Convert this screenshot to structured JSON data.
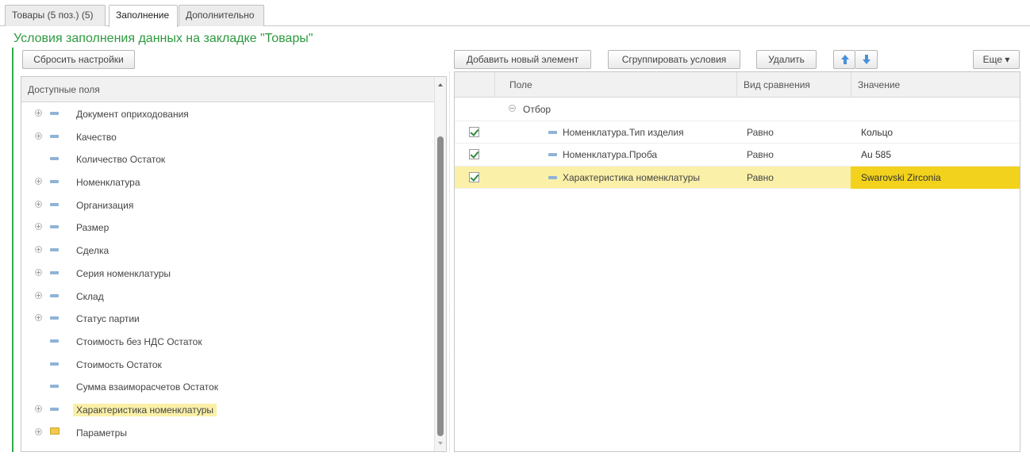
{
  "tabs": [
    {
      "label": "Товары (5 поз.) (5)"
    },
    {
      "label": "Заполнение"
    },
    {
      "label": "Дополнительно"
    }
  ],
  "section_title": "Условия заполнения данных на закладке \"Товары\"",
  "buttons": {
    "reset": "Сбросить настройки",
    "add": "Добавить новый элемент",
    "group": "Сгруппировать условия",
    "delete": "Удалить",
    "more": "Еще ▾"
  },
  "available_fields": {
    "header": "Доступные поля",
    "items": [
      {
        "label": "Документ оприходования",
        "expandable": true,
        "icon": "field-icon"
      },
      {
        "label": "Качество",
        "expandable": true,
        "icon": "field-icon"
      },
      {
        "label": "Количество Остаток",
        "expandable": false,
        "icon": "field-icon"
      },
      {
        "label": "Номенклатура",
        "expandable": true,
        "icon": "field-icon"
      },
      {
        "label": "Организация",
        "expandable": true,
        "icon": "field-icon"
      },
      {
        "label": "Размер",
        "expandable": true,
        "icon": "field-icon"
      },
      {
        "label": "Сделка",
        "expandable": true,
        "icon": "field-icon"
      },
      {
        "label": "Серия номенклатуры",
        "expandable": true,
        "icon": "field-icon"
      },
      {
        "label": "Склад",
        "expandable": true,
        "icon": "field-icon"
      },
      {
        "label": "Статус партии",
        "expandable": true,
        "icon": "field-icon"
      },
      {
        "label": "Стоимость без НДС Остаток",
        "expandable": false,
        "icon": "field-icon"
      },
      {
        "label": "Стоимость Остаток",
        "expandable": false,
        "icon": "field-icon"
      },
      {
        "label": "Сумма взаиморасчетов Остаток",
        "expandable": false,
        "icon": "field-icon"
      },
      {
        "label": "Характеристика номенклатуры",
        "expandable": true,
        "icon": "field-icon",
        "highlighted": true
      },
      {
        "label": "Параметры",
        "expandable": true,
        "icon": "folder-icon"
      }
    ]
  },
  "filter_table": {
    "columns": {
      "field": "Поле",
      "comparison": "Вид сравнения",
      "value": "Значение"
    },
    "group_label": "Отбор",
    "rows": [
      {
        "checked": true,
        "field": "Номенклатура.Тип изделия",
        "comparison": "Равно",
        "value": "Кольцо",
        "selected": false
      },
      {
        "checked": true,
        "field": "Номенклатура.Проба",
        "comparison": "Равно",
        "value": "Au 585",
        "selected": false
      },
      {
        "checked": true,
        "field": "Характеристика номенклатуры",
        "comparison": "Равно",
        "value": "Swarovski Zirconia",
        "selected": true
      }
    ]
  },
  "colors": {
    "title_green": "#2d9a3f",
    "selection_yellow": "#fbf0a8",
    "value_highlight": "#f2d21c",
    "arrow_blue": "#4a90d9"
  }
}
